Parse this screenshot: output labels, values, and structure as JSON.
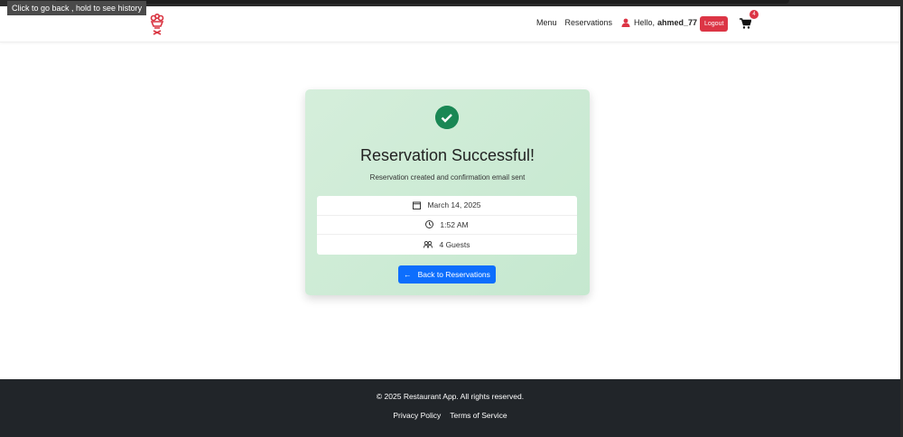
{
  "browser": {
    "tooltip": "Click to go back , hold to see history"
  },
  "nav": {
    "links": [
      "Menu",
      "Reservations"
    ],
    "greeting": "Hello,",
    "username": "ahmed_77",
    "logout": "Logout",
    "cart_count": "4"
  },
  "card": {
    "title": "Reservation Successful!",
    "subtitle": "Reservation created and confirmation email sent",
    "date": "March 14, 2025",
    "time": "1:52 AM",
    "guests": "4 Guests",
    "back_button": "Back to Reservations"
  },
  "footer": {
    "copyright": "© 2025 Restaurant App. All rights reserved.",
    "links": [
      "Privacy Policy",
      "Terms of Service"
    ]
  },
  "colors": {
    "success": "#198754",
    "primary": "#0d6efd",
    "danger": "#dc3545",
    "footer": "#212529"
  }
}
